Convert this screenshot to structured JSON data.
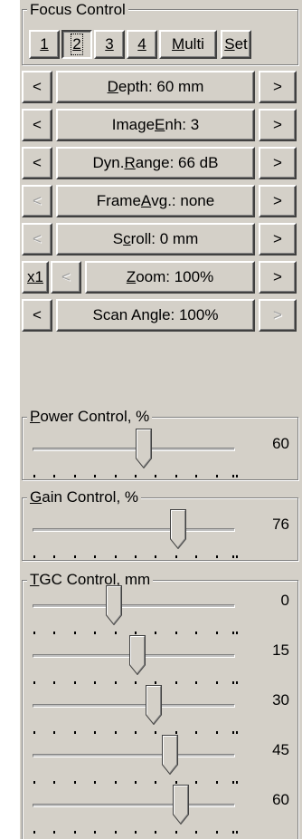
{
  "focus_control": {
    "title": "Focus Control",
    "buttons": [
      {
        "label": "1",
        "mnemonic": "1",
        "rest": ""
      },
      {
        "label": "2",
        "mnemonic": "2",
        "rest": "",
        "selected": true
      },
      {
        "label": "3",
        "mnemonic": "3",
        "rest": ""
      },
      {
        "label": "4",
        "mnemonic": "4",
        "rest": ""
      },
      {
        "label": "Multi",
        "mnemonic": "M",
        "rest": "ulti"
      },
      {
        "label": "Set",
        "mnemonic": "S",
        "rest": "et"
      }
    ]
  },
  "rows": [
    {
      "prev": "<",
      "next": ">",
      "pre": "",
      "mn": "D",
      "post": "epth: 60 mm",
      "prev_enabled": true,
      "next_enabled": true
    },
    {
      "prev": "<",
      "next": ">",
      "pre": "Image ",
      "mn": "E",
      "post": "nh: 3",
      "prev_enabled": true,
      "next_enabled": true
    },
    {
      "prev": "<",
      "next": ">",
      "pre": "Dyn. ",
      "mn": "R",
      "post": "ange: 66 dB",
      "prev_enabled": true,
      "next_enabled": true
    },
    {
      "prev": "<",
      "next": ">",
      "pre": "Frame ",
      "mn": "A",
      "post": "vg.: none",
      "prev_enabled": false,
      "next_enabled": true
    },
    {
      "prev": "<",
      "next": ">",
      "pre": "S",
      "mn": "c",
      "post": "roll: 0 mm",
      "prev_enabled": false,
      "next_enabled": true
    },
    {
      "x1": "x1",
      "prev": "<",
      "next": ">",
      "pre": "",
      "mn": "Z",
      "post": "oom: 100%",
      "prev_enabled": false,
      "next_enabled": true
    },
    {
      "prev": "<",
      "next": ">",
      "pre": "Scan Angle: 100%",
      "mn": "",
      "post": "",
      "prev_enabled": true,
      "next_enabled": false
    }
  ],
  "power": {
    "pre": "",
    "mn": "P",
    "post": "ower Control, %",
    "value": "60",
    "level": 0.55
  },
  "gain": {
    "pre": "",
    "mn": "G",
    "post": "ain Control, %",
    "value": "76",
    "level": 0.72
  },
  "tgc": {
    "pre": "",
    "mn": "T",
    "post": "GC Control, mm",
    "sliders": [
      {
        "value": "0",
        "level": 0.4
      },
      {
        "value": "15",
        "level": 0.52
      },
      {
        "value": "30",
        "level": 0.6
      },
      {
        "value": "45",
        "level": 0.68
      },
      {
        "value": "60",
        "level": 0.73
      }
    ]
  }
}
